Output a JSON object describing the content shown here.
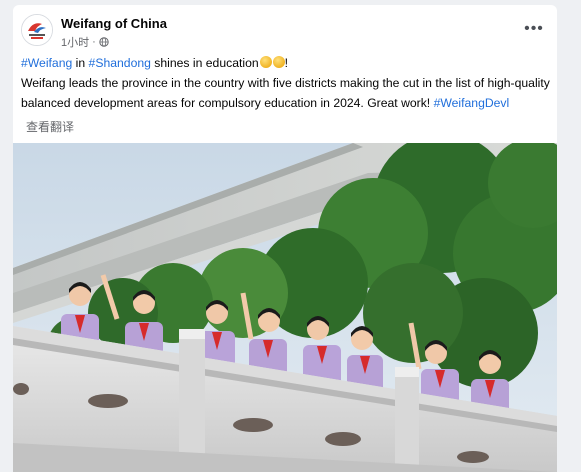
{
  "post": {
    "page_name": "Weifang of China",
    "timestamp": "1小时",
    "separator": "·",
    "more_label": "•••",
    "line1": {
      "hashtag1": "#Weifang",
      "in": " in ",
      "hashtag2": "#Shandong",
      "rest": " shines in education",
      "tail": "!"
    },
    "line2": {
      "text": "Weifang leads the province in the country with five districts making the cut in the list of high-quality balanced development areas for compulsory education in 2024. Great work! ",
      "hashtag": "#WeifangDevl"
    },
    "translate_label": "查看翻译"
  },
  "icons": {
    "privacy": "globe-icon",
    "more": "more-dots-icon",
    "avatar": "page-logo-avatar"
  },
  "colors": {
    "hashtag": "#216fdb",
    "meta": "#65676b",
    "background": "#eef0f3"
  }
}
